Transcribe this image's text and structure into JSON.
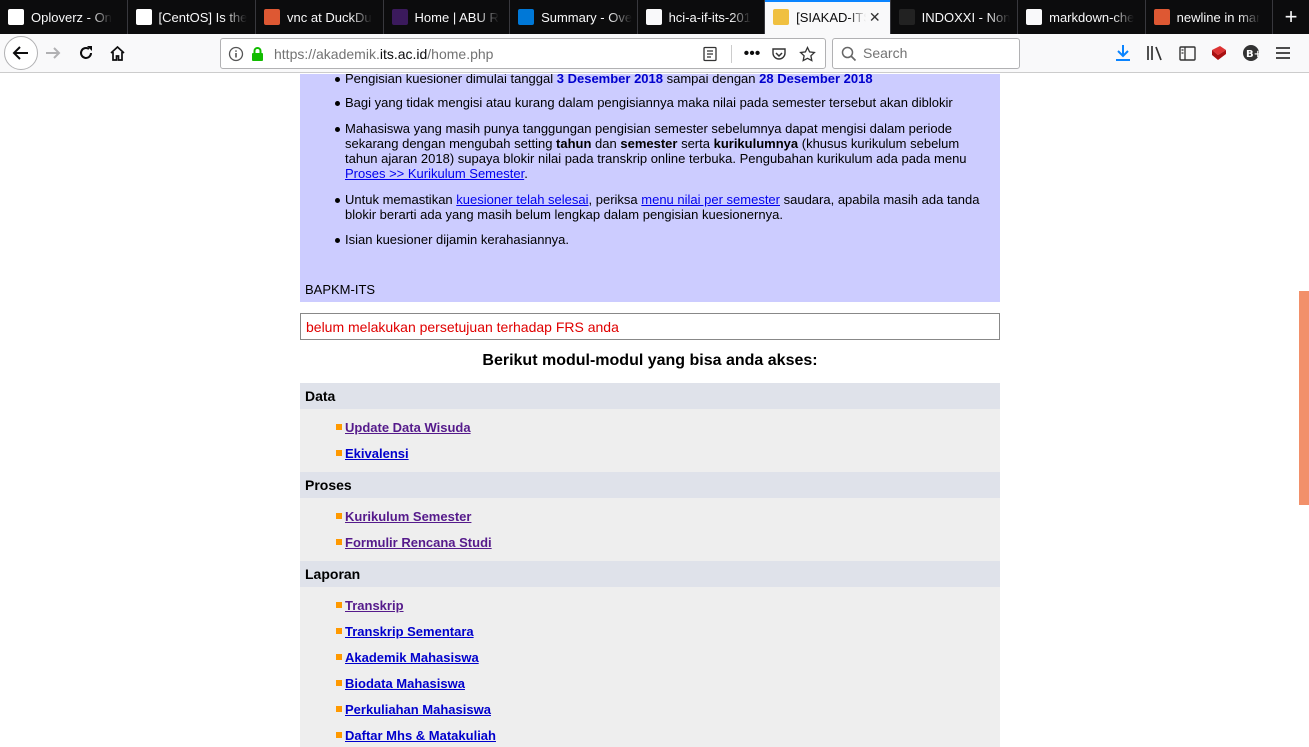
{
  "browser": {
    "tabs": [
      {
        "label": "Oploverz - On",
        "icon": "oploverz-icon",
        "fav_bg": "#ffffff",
        "fav_fg": "#c00"
      },
      {
        "label": "[CentOS] Is the",
        "icon": "gb-icon",
        "fav_bg": "#ffffff",
        "fav_fg": "#4a6fa5"
      },
      {
        "label": "vnc at DuckDu",
        "icon": "duckduckgo-icon",
        "fav_bg": "#de5833",
        "fav_fg": "#fff"
      },
      {
        "label": "Home | ABU R",
        "icon": "abu-icon",
        "fav_bg": "#3b1a5c",
        "fav_fg": "#fff"
      },
      {
        "label": "Summary - Ove",
        "icon": "azure-icon",
        "fav_bg": "#0078d7",
        "fav_fg": "#fff"
      },
      {
        "label": "hci-a-if-its-201",
        "icon": "github-icon",
        "fav_bg": "#f9f9fa",
        "fav_fg": "#000"
      },
      {
        "label": "[SIAKAD-ITS",
        "icon": "siakad-icon",
        "fav_bg": "#f0c040",
        "fav_fg": "#c00"
      },
      {
        "label": "INDOXXI - Non",
        "icon": "indoxxi-icon",
        "fav_bg": "#222",
        "fav_fg": "#f0c040"
      },
      {
        "label": "markdown-che",
        "icon": "github-icon",
        "fav_bg": "#f9f9fa",
        "fav_fg": "#000"
      },
      {
        "label": "newline in mar",
        "icon": "duckduckgo-icon",
        "fav_bg": "#de5833",
        "fav_fg": "#fff"
      }
    ],
    "active_tab": 6,
    "url_domain_prefix": "https://akademik.",
    "url_domain": "its.ac.id",
    "url_path": "/home.php",
    "search_placeholder": "Search"
  },
  "notice": {
    "items": [
      {
        "parts": [
          {
            "t": "Pengisian kuesioner dimulai tanggal "
          },
          {
            "t": "3 Desember 2018",
            "s": "bl"
          },
          {
            "t": " sampai dengan "
          },
          {
            "t": "28 Desember 2018",
            "s": "bl"
          }
        ]
      },
      {
        "parts": [
          {
            "t": "Bagi yang tidak mengisi atau kurang dalam pengisiannya maka nilai pada semester tersebut akan diblokir"
          }
        ]
      },
      {
        "parts": [
          {
            "t": "Mahasiswa yang masih punya tanggungan pengisian semester sebelumnya dapat mengisi dalam periode sekarang dengan mengubah setting "
          },
          {
            "t": "tahun",
            "s": "b"
          },
          {
            "t": " dan "
          },
          {
            "t": "semester",
            "s": "b"
          },
          {
            "t": " serta "
          },
          {
            "t": "kurikulumnya",
            "s": "b"
          },
          {
            "t": " (khusus kurikulum sebelum tahun ajaran 2018) supaya blokir nilai pada transkrip online terbuka. Pengubahan kurikulum ada pada menu "
          },
          {
            "t": "Proses >> Kurikulum Semester",
            "s": "a"
          },
          {
            "t": "."
          }
        ]
      },
      {
        "parts": [
          {
            "t": "Untuk memastikan "
          },
          {
            "t": "kuesioner telah selesai",
            "s": "a"
          },
          {
            "t": ", periksa "
          },
          {
            "t": "menu nilai per semester",
            "s": "a"
          },
          {
            "t": " saudara, apabila masih ada tanda blokir berarti ada yang masih belum lengkap dalam pengisian kuesionernya."
          }
        ]
      },
      {
        "parts": [
          {
            "t": "Isian kuesioner dijamin kerahasiannya."
          }
        ]
      }
    ],
    "signature": "BAPKM-ITS"
  },
  "alert_text": "belum melakukan persetujuan terhadap FRS anda",
  "modules_title": "Berikut modul-modul yang bisa anda akses:",
  "categories": [
    {
      "name": "Data",
      "links": [
        {
          "label": "Update Data Wisuda",
          "visited": true
        },
        {
          "label": "Ekivalensi",
          "visited": false
        }
      ]
    },
    {
      "name": "Proses",
      "links": [
        {
          "label": "Kurikulum Semester",
          "visited": true
        },
        {
          "label": "Formulir Rencana Studi",
          "visited": true
        }
      ]
    },
    {
      "name": "Laporan",
      "links": [
        {
          "label": "Transkrip",
          "visited": true
        },
        {
          "label": "Transkrip Sementara",
          "visited": false
        },
        {
          "label": "Akademik Mahasiswa",
          "visited": false
        },
        {
          "label": "Biodata Mahasiswa",
          "visited": false
        },
        {
          "label": "Perkuliahan Mahasiswa",
          "visited": false
        },
        {
          "label": "Daftar Mhs & Matakuliah",
          "visited": false
        }
      ]
    }
  ]
}
